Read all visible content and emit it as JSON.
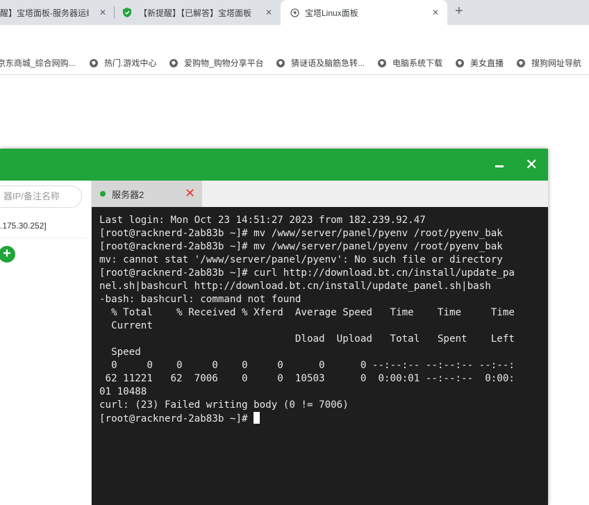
{
  "browser": {
    "tabs": [
      {
        "label": "醒】宝塔面板-服务器运维",
        "close": "✕"
      },
      {
        "label": "【新提醒】【已解答】宝塔面板",
        "close": "✕"
      },
      {
        "label": "宝塔Linux面板",
        "close": "✕"
      }
    ],
    "new_tab": "+",
    "bookmarks": [
      "京东商城_综合网购...",
      "热门.游戏中心",
      "爱购物_购物分享平台",
      "猜谜语及脑筋急转...",
      "电脑系统下载",
      "美女直播",
      "搜狗网址导航"
    ]
  },
  "panel": {
    "accent_color": "#20a53a",
    "close_glyph": "✕",
    "sidebar": {
      "search_placeholder": "器IP/备注名称",
      "server_ip": ".175.30.252]",
      "add_glyph": "+"
    },
    "session_tab": {
      "label": "服务器2",
      "close": "✕"
    },
    "terminal": {
      "lines": [
        "Last login: Mon Oct 23 14:51:27 2023 from 182.239.92.47",
        "[root@racknerd-2ab83b ~]# mv /www/server/panel/pyenv /root/pyenv_bak",
        "[root@racknerd-2ab83b ~]# mv /www/server/panel/pyenv /root/pyenv_bak",
        "mv: cannot stat '/www/server/panel/pyenv': No such file or directory",
        "[root@racknerd-2ab83b ~]# curl http://download.bt.cn/install/update_pa",
        "nel.sh|bashcurl http://download.bt.cn/install/update_panel.sh|bash",
        "-bash: bashcurl: command not found",
        "  % Total    % Received % Xferd  Average Speed   Time    Time     Time",
        "  Current",
        "                                 Dload  Upload   Total   Spent    Left",
        "  Speed",
        "  0     0    0     0    0     0      0      0 --:--:-- --:--:-- --:--:",
        " 62 11221   62  7006    0     0  10503      0  0:00:01 --:--:--  0:00:",
        "01 10488",
        "curl: (23) Failed writing body (0 != 7006)"
      ],
      "prompt": "[root@racknerd-2ab83b ~]# "
    }
  }
}
